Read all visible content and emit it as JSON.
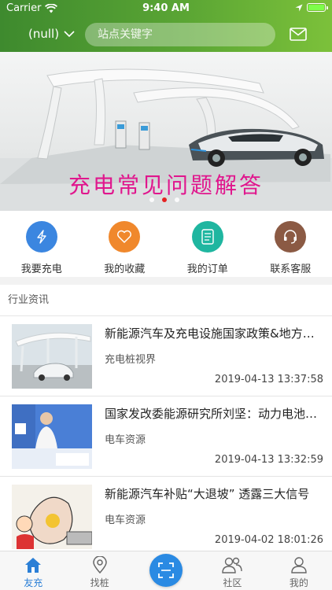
{
  "status_bar": {
    "carrier": "Carrier",
    "time": "9:40 AM"
  },
  "header": {
    "city": "(null)",
    "search_placeholder": "站点关键字"
  },
  "banner": {
    "caption": "充电常见问题解答",
    "slides": 3,
    "active_slide": 2
  },
  "quick_actions": [
    {
      "label": "我要充电",
      "icon": "lightning-icon",
      "color": "#3b86e0"
    },
    {
      "label": "我的收藏",
      "icon": "heart-icon",
      "color": "#f0882c"
    },
    {
      "label": "我的订单",
      "icon": "document-icon",
      "color": "#1fb6a0"
    },
    {
      "label": "联系客服",
      "icon": "headset-icon",
      "color": "#8b5a44"
    }
  ],
  "news": {
    "section_title": "行业资讯",
    "articles": [
      {
        "title": "新能源汽车及充电设施国家政策&地方政策",
        "source": "充电桩视界",
        "time": "2019-04-13 13:37:58"
      },
      {
        "title": "国家发改委能源研究所刘坚：动力电池储能",
        "source": "电车资源",
        "time": "2019-04-13 13:32:59"
      },
      {
        "title": "新能源汽车补贴“大退坡” 透露三大信号",
        "source": "电车资源",
        "time": "2019-04-02 18:01:26"
      }
    ]
  },
  "tabbar": [
    {
      "label": "友充",
      "icon": "home-icon",
      "active": true
    },
    {
      "label": "找桩",
      "icon": "location-pin-icon",
      "active": false
    },
    {
      "label": "",
      "icon": "scan-icon",
      "active": false
    },
    {
      "label": "社区",
      "icon": "community-icon",
      "active": false
    },
    {
      "label": "我的",
      "icon": "user-icon",
      "active": false
    }
  ]
}
